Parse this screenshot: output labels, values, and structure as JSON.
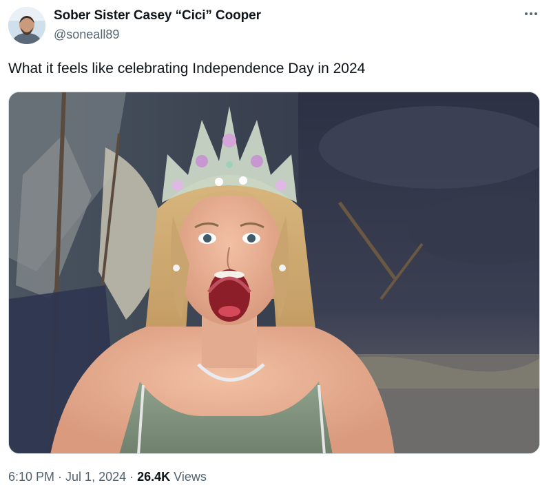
{
  "author": {
    "display_name": "Sober Sister Casey “Cici” Cooper",
    "handle": "@soneall89",
    "avatar_icon": "profile-photo-avatar"
  },
  "tweet": {
    "text": "What it feels like celebrating Independence Day in 2024",
    "media_icon": "screaming-pageant-queen-photo"
  },
  "meta": {
    "time": "6:10 PM",
    "separator": " · ",
    "date": "Jul 1, 2024",
    "views_count": "26.4K",
    "views_label": " Views"
  },
  "more_icon": "more-dots-icon",
  "colors": {
    "text_primary": "#0f1419",
    "text_secondary": "#536471",
    "border": "#cfd9de"
  }
}
